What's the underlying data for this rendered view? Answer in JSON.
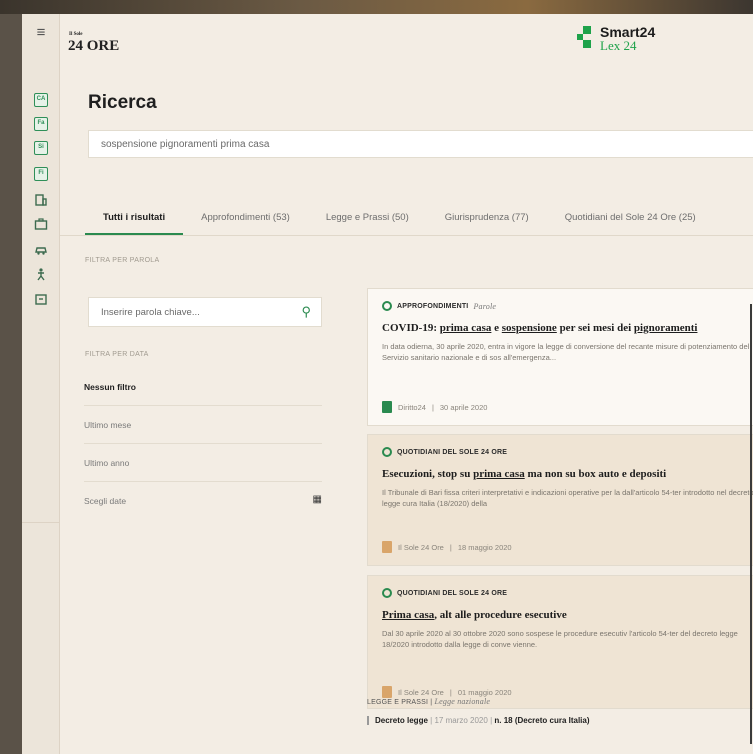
{
  "header": {
    "logo_sup": "Il Sole",
    "logo": "24 ORE",
    "brand_title": "Smart24",
    "brand_sub": "Lex 24"
  },
  "rail": {
    "icons": [
      "menu-icon",
      "cat-icon",
      "fac-icon",
      "sic-icon",
      "fis-icon",
      "building-icon",
      "briefcase-icon",
      "car-icon",
      "person-icon",
      "chat-icon"
    ]
  },
  "page": {
    "title": "Ricerca",
    "search_value": "sospensione pignoramenti prima casa"
  },
  "tabs": [
    {
      "label": "Tutti i risultati",
      "active": true
    },
    {
      "label": "Approfondimenti (53)"
    },
    {
      "label": "Legge e Prassi (50)"
    },
    {
      "label": "Giurisprudenza (77)"
    },
    {
      "label": "Quotidiani del Sole 24 Ore (25)"
    }
  ],
  "filters": {
    "word_label": "FILTRA PER PAROLA",
    "keyword_placeholder": "Inserire parola chiave...",
    "date_label": "FILTRA PER DATA",
    "options": [
      "Nessun filtro",
      "Ultimo mese",
      "Ultimo anno",
      "Scegli date"
    ]
  },
  "results": [
    {
      "source": "APPROFONDIMENTI",
      "subtype": "Parole",
      "title_pre": "COVID-19: ",
      "title_u1": "prima casa",
      "title_mid": " e ",
      "title_u2": "sospensione",
      "title_post": " per sei mesi dei ",
      "title_u3": "pignoramenti",
      "body": "In data odierna, 30 aprile 2020, entra in vigore la legge di conversione del recante misure di potenziamento del Servizio sanitario nazionale e di sos all'emergenza...",
      "meta_source": "Diritto24",
      "meta_date": "30 aprile 2020"
    },
    {
      "source": "QUOTIDIANI DEL SOLE 24 ORE",
      "title_pre": "Esecuzioni, stop su ",
      "title_u1": "prima casa",
      "title_post": " ma non su box auto e depositi",
      "body": "Il Tribunale di Bari fissa criteri interpretativi e indicazioni operative per la dall'articolo 54-ter introdotto nel decreto legge cura Italia (18/2020) della",
      "meta_source": "Il Sole 24 Ore",
      "meta_date": "18 maggio 2020"
    },
    {
      "source": "QUOTIDIANI DEL SOLE 24 ORE",
      "title_u1": "Prima casa",
      "title_post": ", alt alle procedure esecutive",
      "body": "Dal 30 aprile 2020 al 30 ottobre 2020 sono sospese le procedure esecutiv l'articolo 54-ter del decreto legge 18/2020 introdotto dalla legge di conve vienne.",
      "meta_source": "Il Sole 24 Ore",
      "meta_date": "01 maggio 2020"
    }
  ],
  "legge": {
    "source": "LEGGE E PRASSI",
    "subtype": "Legge nazionale",
    "doc": "Decreto legge",
    "date": "17 marzo 2020",
    "num": "n. 18 (Decreto cura Italia)"
  },
  "colors": {
    "accent": "#2a8a4f",
    "background": "#f3ede4",
    "card_beige": "#efe4d4"
  }
}
